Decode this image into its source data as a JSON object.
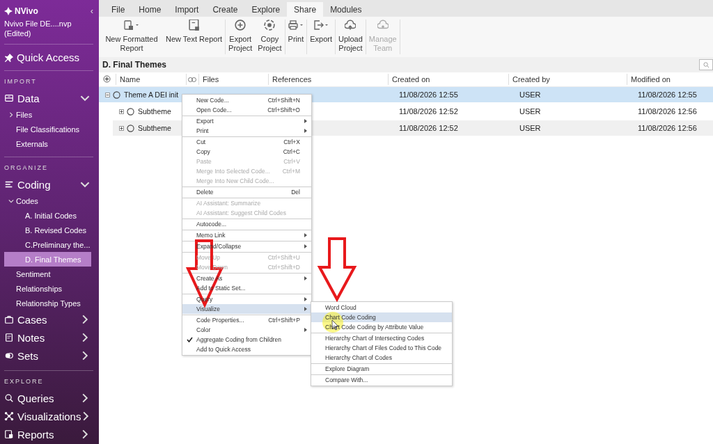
{
  "sidebar": {
    "logo": "NVivo",
    "collapse": "‹",
    "project": "Nvivo File DE....nvp (Edited)",
    "quick_access": "Quick Access",
    "sections": [
      {
        "heading": "IMPORT",
        "items": [
          {
            "label": "Data",
            "expanded": true,
            "children": [
              {
                "label": "Files",
                "expanded": false
              },
              {
                "label": "File Classifications"
              },
              {
                "label": "Externals"
              }
            ]
          }
        ]
      },
      {
        "heading": "ORGANIZE",
        "items": [
          {
            "label": "Coding",
            "expanded": true,
            "children": [
              {
                "label": "Codes",
                "expanded": true,
                "children": [
                  {
                    "label": "A. Initial Codes",
                    "selected": false
                  },
                  {
                    "label": "B. Revised Codes",
                    "selected": false
                  },
                  {
                    "label": "C.Preliminary the...",
                    "selected": false
                  },
                  {
                    "label": "D. Final Themes",
                    "selected": true
                  }
                ]
              },
              {
                "label": "Sentiment"
              },
              {
                "label": "Relationships"
              },
              {
                "label": "Relationship Types"
              }
            ]
          },
          {
            "label": "Cases",
            "expanded": false
          },
          {
            "label": "Notes",
            "expanded": false
          },
          {
            "label": "Sets",
            "expanded": false
          }
        ]
      },
      {
        "heading": "EXPLORE",
        "items": [
          {
            "label": "Queries",
            "expanded": false
          },
          {
            "label": "Visualizations",
            "expanded": false
          },
          {
            "label": "Reports",
            "expanded": false
          }
        ]
      }
    ]
  },
  "tabs": [
    {
      "label": "File",
      "selected": false
    },
    {
      "label": "Home",
      "selected": false
    },
    {
      "label": "Import",
      "selected": false
    },
    {
      "label": "Create",
      "selected": false
    },
    {
      "label": "Explore",
      "selected": false
    },
    {
      "label": "Share",
      "selected": true
    },
    {
      "label": "Modules",
      "selected": false
    }
  ],
  "ribbon": [
    [
      {
        "label": "New Formatted Report",
        "disabled": false
      },
      {
        "label": "New Text Report",
        "disabled": false
      }
    ],
    [
      {
        "label": "Export Project",
        "disabled": false
      },
      {
        "label": "Copy Project",
        "disabled": false
      }
    ],
    [
      {
        "label": "Print",
        "disabled": false
      }
    ],
    [
      {
        "label": "Export",
        "disabled": false
      }
    ],
    [
      {
        "label": "Upload Project",
        "disabled": false
      }
    ],
    [
      {
        "label": "Manage Team",
        "disabled": true
      }
    ]
  ],
  "view_title": "D. Final Themes",
  "table": {
    "columns": [
      "Name",
      "Files",
      "References",
      "Created on",
      "Created by",
      "Modified on"
    ],
    "rows": [
      {
        "name": "Theme A DEI init",
        "created_on": "11/08/2026 12:55",
        "created_by": "USER",
        "modified_on": "11/08/2026 12:55",
        "selected": true,
        "expanded": true
      },
      {
        "name": "Subtheme",
        "created_on": "11/08/2026 12:52",
        "created_by": "USER",
        "modified_on": "11/08/2026 12:56",
        "selected": false,
        "expanded": false
      },
      {
        "name": "Subtheme",
        "created_on": "11/08/2026 12:52",
        "created_by": "USER",
        "modified_on": "11/08/2026 12:56",
        "selected": false,
        "expanded": false
      }
    ]
  },
  "context_menu": [
    [
      {
        "label": "New Code...",
        "shortcut": "Ctrl+Shift+N",
        "disabled": false,
        "submenu": false,
        "selected": false
      },
      {
        "label": "Open Code...",
        "shortcut": "Ctrl+Shift+O",
        "disabled": false,
        "submenu": false,
        "selected": false
      }
    ],
    [
      {
        "label": "Export",
        "disabled": false,
        "submenu": true,
        "selected": false
      },
      {
        "label": "Print",
        "disabled": false,
        "submenu": true,
        "selected": false
      }
    ],
    [
      {
        "label": "Cut",
        "shortcut": "Ctrl+X",
        "disabled": false,
        "submenu": false,
        "selected": false
      },
      {
        "label": "Copy",
        "shortcut": "Ctrl+C",
        "disabled": false,
        "submenu": false,
        "selected": false
      },
      {
        "label": "Paste",
        "shortcut": "Ctrl+V",
        "disabled": true,
        "submenu": false,
        "selected": false
      },
      {
        "label": "Merge Into Selected Code...",
        "shortcut": "Ctrl+M",
        "disabled": true,
        "submenu": false,
        "selected": false
      },
      {
        "label": "Merge Into New Child Code...",
        "disabled": true,
        "submenu": false,
        "selected": false
      }
    ],
    [
      {
        "label": "Delete",
        "shortcut": "Del",
        "disabled": false,
        "submenu": false,
        "selected": false
      }
    ],
    [
      {
        "label": "AI Assistant: Summarize",
        "disabled": true,
        "submenu": false,
        "selected": false
      },
      {
        "label": "AI Assistant: Suggest Child Codes",
        "disabled": true,
        "submenu": false,
        "selected": false
      }
    ],
    [
      {
        "label": "Autocode...",
        "disabled": false,
        "submenu": false,
        "selected": false
      }
    ],
    [
      {
        "label": "Memo Link",
        "disabled": false,
        "submenu": true,
        "selected": false
      }
    ],
    [
      {
        "label": "Expand/Collapse",
        "disabled": false,
        "submenu": true,
        "selected": false
      }
    ],
    [
      {
        "label": "Move Up",
        "shortcut": "Ctrl+Shift+U",
        "disabled": true,
        "submenu": false,
        "selected": false
      },
      {
        "label": "Move Down",
        "shortcut": "Ctrl+Shift+D",
        "disabled": true,
        "submenu": false,
        "selected": false
      }
    ],
    [
      {
        "label": "Create As",
        "disabled": false,
        "submenu": true,
        "selected": false
      },
      {
        "label": "Add to Static Set...",
        "disabled": false,
        "submenu": false,
        "selected": false
      }
    ],
    [
      {
        "label": "Query",
        "disabled": false,
        "submenu": true,
        "selected": false
      },
      {
        "label": "Visualize",
        "disabled": false,
        "submenu": true,
        "selected": true
      }
    ],
    [
      {
        "label": "Code Properties...",
        "shortcut": "Ctrl+Shift+P",
        "disabled": false,
        "submenu": false,
        "selected": false,
        "checked": false
      },
      {
        "label": "Color",
        "disabled": false,
        "submenu": true,
        "selected": false,
        "checked": false
      },
      {
        "label": "Aggregate Coding from Children",
        "disabled": false,
        "submenu": false,
        "selected": false,
        "checked": true
      },
      {
        "label": "Add to Quick Access",
        "disabled": false,
        "submenu": false,
        "selected": false,
        "checked": false
      }
    ]
  ],
  "submenu": [
    [
      {
        "label": "Word Cloud",
        "selected": false
      },
      {
        "label": "Chart Code Coding",
        "selected": true
      },
      {
        "label": "Chart Code Coding by Attribute Value",
        "selected": false
      }
    ],
    [
      {
        "label": "Hierarchy Chart of Intersecting Codes",
        "selected": false
      },
      {
        "label": "Hierarchy Chart of Files Coded to This Code",
        "selected": false
      },
      {
        "label": "Hierarchy Chart of Codes",
        "selected": false
      }
    ],
    [
      {
        "label": "Explore Diagram",
        "selected": false
      }
    ],
    [
      {
        "label": "Compare With...",
        "selected": false
      }
    ]
  ]
}
